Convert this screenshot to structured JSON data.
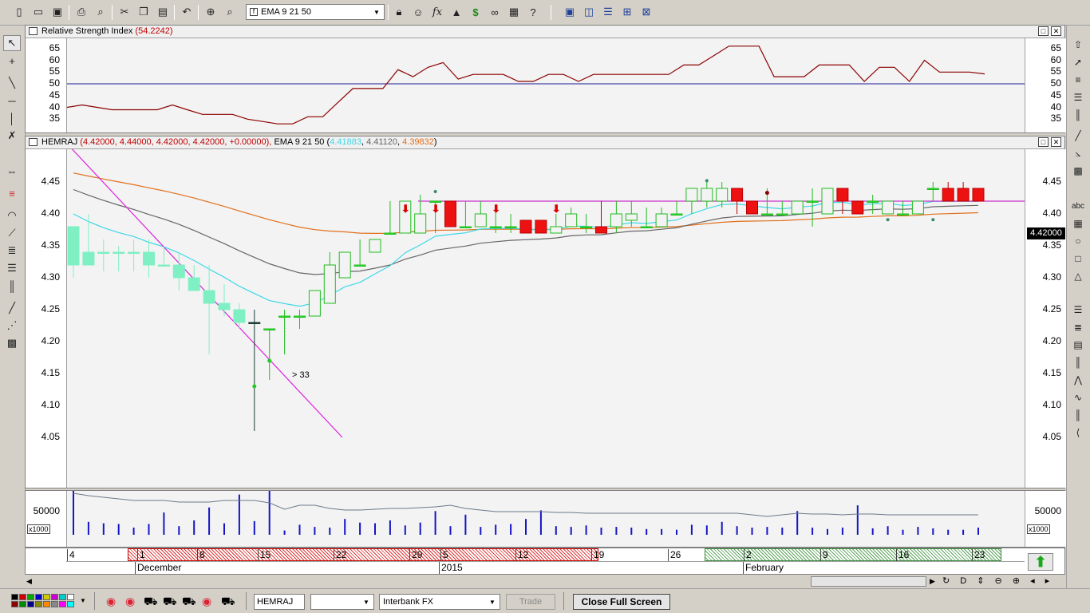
{
  "toolbar": {
    "indicator_combo": "EMA 9 21 50",
    "tooltips": [
      "new",
      "open",
      "save",
      "print",
      "preview",
      "cut",
      "copy",
      "paste",
      "undo",
      "crosshair",
      "zoom",
      "help"
    ]
  },
  "rsi_panel": {
    "title": "Relative Strength Index",
    "value": "(54.2242)",
    "ticks": [
      "65",
      "60",
      "55",
      "50",
      "45",
      "40",
      "35"
    ]
  },
  "price_panel": {
    "symbol": "HEMRAJ",
    "ohlc": "(4.42000, 4.44000, 4.42000, 4.42000, +0.00000),",
    "ema_label": "EMA 9 21 50",
    "ema_values": [
      "4.41883",
      "4.41120",
      "4.39832"
    ],
    "ema_colors": [
      "#3fd8e8",
      "#666666",
      "#e0701c"
    ],
    "ticks": [
      "4.45",
      "4.40",
      "4.35",
      "4.30",
      "4.25",
      "4.20",
      "4.15",
      "4.10",
      "4.05"
    ],
    "last_price": "4.42000",
    "annotation": "> 33"
  },
  "volume_panel": {
    "tick": "50000",
    "multiplier": "x1000"
  },
  "date_axis": {
    "days": [
      "4",
      "1",
      "8",
      "15",
      "22",
      "29",
      "5",
      "12",
      "19",
      "26",
      "2",
      "9",
      "16",
      "23"
    ],
    "months": [
      "December",
      "2015",
      "February"
    ]
  },
  "bottom_bar": {
    "symbol_field": "HEMRAJ",
    "empty_combo": "",
    "feed_combo": "Interbank FX",
    "trade_button": "Trade",
    "close_full_screen": "Close Full Screen"
  },
  "chart_data": {
    "type": "candlestick",
    "symbol": "HEMRAJ",
    "x": [
      "Nov 28",
      "Dec 1",
      "Dec 2",
      "Dec 3",
      "Dec 4",
      "Dec 5",
      "Dec 8",
      "Dec 9",
      "Dec 10",
      "Dec 11",
      "Dec 12",
      "Dec 15",
      "Dec 16",
      "Dec 17",
      "Dec 18",
      "Dec 19",
      "Dec 22",
      "Dec 23",
      "Dec 24",
      "Dec 25",
      "Dec 26",
      "Dec 29",
      "Dec 30",
      "Dec 31",
      "Jan 2",
      "Jan 5",
      "Jan 6",
      "Jan 7",
      "Jan 8",
      "Jan 9",
      "Jan 12",
      "Jan 13",
      "Jan 14",
      "Jan 15",
      "Jan 16",
      "Jan 19",
      "Jan 20",
      "Jan 21",
      "Jan 22",
      "Jan 23",
      "Jan 26",
      "Jan 27",
      "Jan 28",
      "Jan 29",
      "Jan 30",
      "Feb 2",
      "Feb 3",
      "Feb 4",
      "Feb 5",
      "Feb 6",
      "Feb 9",
      "Feb 10",
      "Feb 11",
      "Feb 12",
      "Feb 13",
      "Feb 16",
      "Feb 17",
      "Feb 18",
      "Feb 19",
      "Feb 20",
      "Feb 23"
    ],
    "open": [
      4.38,
      4.32,
      4.34,
      4.34,
      4.34,
      4.34,
      4.32,
      4.32,
      4.3,
      4.28,
      4.26,
      4.25,
      4.23,
      4.22,
      4.24,
      4.24,
      4.24,
      4.26,
      4.3,
      4.32,
      4.34,
      4.37,
      4.37,
      4.37,
      4.42,
      4.42,
      4.38,
      4.38,
      4.38,
      4.38,
      4.39,
      4.39,
      4.37,
      4.38,
      4.38,
      4.38,
      4.38,
      4.39,
      4.38,
      4.38,
      4.4,
      4.42,
      4.42,
      4.42,
      4.44,
      4.42,
      4.4,
      4.4,
      4.4,
      4.42,
      4.4,
      4.44,
      4.42,
      4.42,
      4.4,
      4.4,
      4.4,
      4.44,
      4.44,
      4.44,
      4.44
    ],
    "high": [
      4.38,
      4.4,
      4.36,
      4.35,
      4.36,
      4.36,
      4.35,
      4.34,
      4.32,
      4.32,
      4.29,
      4.26,
      4.25,
      4.22,
      4.25,
      4.25,
      4.28,
      4.34,
      4.34,
      4.36,
      4.35,
      4.42,
      4.42,
      4.43,
      4.42,
      4.41,
      4.42,
      4.42,
      4.41,
      4.4,
      4.39,
      4.39,
      4.4,
      4.41,
      4.4,
      4.42,
      4.42,
      4.42,
      4.41,
      4.41,
      4.42,
      4.44,
      4.45,
      4.45,
      4.44,
      4.42,
      4.44,
      4.42,
      4.42,
      4.44,
      4.44,
      4.44,
      4.42,
      4.43,
      4.42,
      4.42,
      4.42,
      4.45,
      4.45,
      4.45,
      4.44
    ],
    "low": [
      4.3,
      4.32,
      4.31,
      4.31,
      4.31,
      4.3,
      4.32,
      4.28,
      4.28,
      4.18,
      4.24,
      4.22,
      4.06,
      4.14,
      4.18,
      4.22,
      4.24,
      4.26,
      4.3,
      4.32,
      4.34,
      4.37,
      4.37,
      4.37,
      4.37,
      4.38,
      4.38,
      4.38,
      4.37,
      4.37,
      4.37,
      4.37,
      4.37,
      4.38,
      4.37,
      4.37,
      4.37,
      4.38,
      4.38,
      4.38,
      4.4,
      4.4,
      4.41,
      4.41,
      4.4,
      4.4,
      4.4,
      4.4,
      4.4,
      4.38,
      4.4,
      4.4,
      4.4,
      4.4,
      4.4,
      4.4,
      4.4,
      4.42,
      4.42,
      4.42,
      4.42
    ],
    "close": [
      4.32,
      4.34,
      4.34,
      4.34,
      4.34,
      4.32,
      4.32,
      4.3,
      4.28,
      4.26,
      4.25,
      4.23,
      4.23,
      4.22,
      4.24,
      4.24,
      4.28,
      4.32,
      4.34,
      4.32,
      4.36,
      4.37,
      4.42,
      4.4,
      4.42,
      4.38,
      4.38,
      4.4,
      4.38,
      4.38,
      4.37,
      4.37,
      4.38,
      4.4,
      4.38,
      4.37,
      4.4,
      4.4,
      4.38,
      4.4,
      4.4,
      4.44,
      4.44,
      4.44,
      4.42,
      4.4,
      4.4,
      4.4,
      4.42,
      4.42,
      4.44,
      4.42,
      4.4,
      4.42,
      4.42,
      4.4,
      4.42,
      4.44,
      4.42,
      4.42,
      4.42
    ],
    "ema": [
      {
        "name": "EMA 9",
        "last": 4.41883
      },
      {
        "name": "EMA 21",
        "last": 4.4112
      },
      {
        "name": "EMA 50",
        "last": 4.39832
      }
    ],
    "ylim": [
      4.03,
      4.52
    ],
    "rsi": {
      "last": 54.2242,
      "ylim": [
        30,
        70
      ],
      "level": 50
    },
    "volume_axis_tick": 50000
  }
}
